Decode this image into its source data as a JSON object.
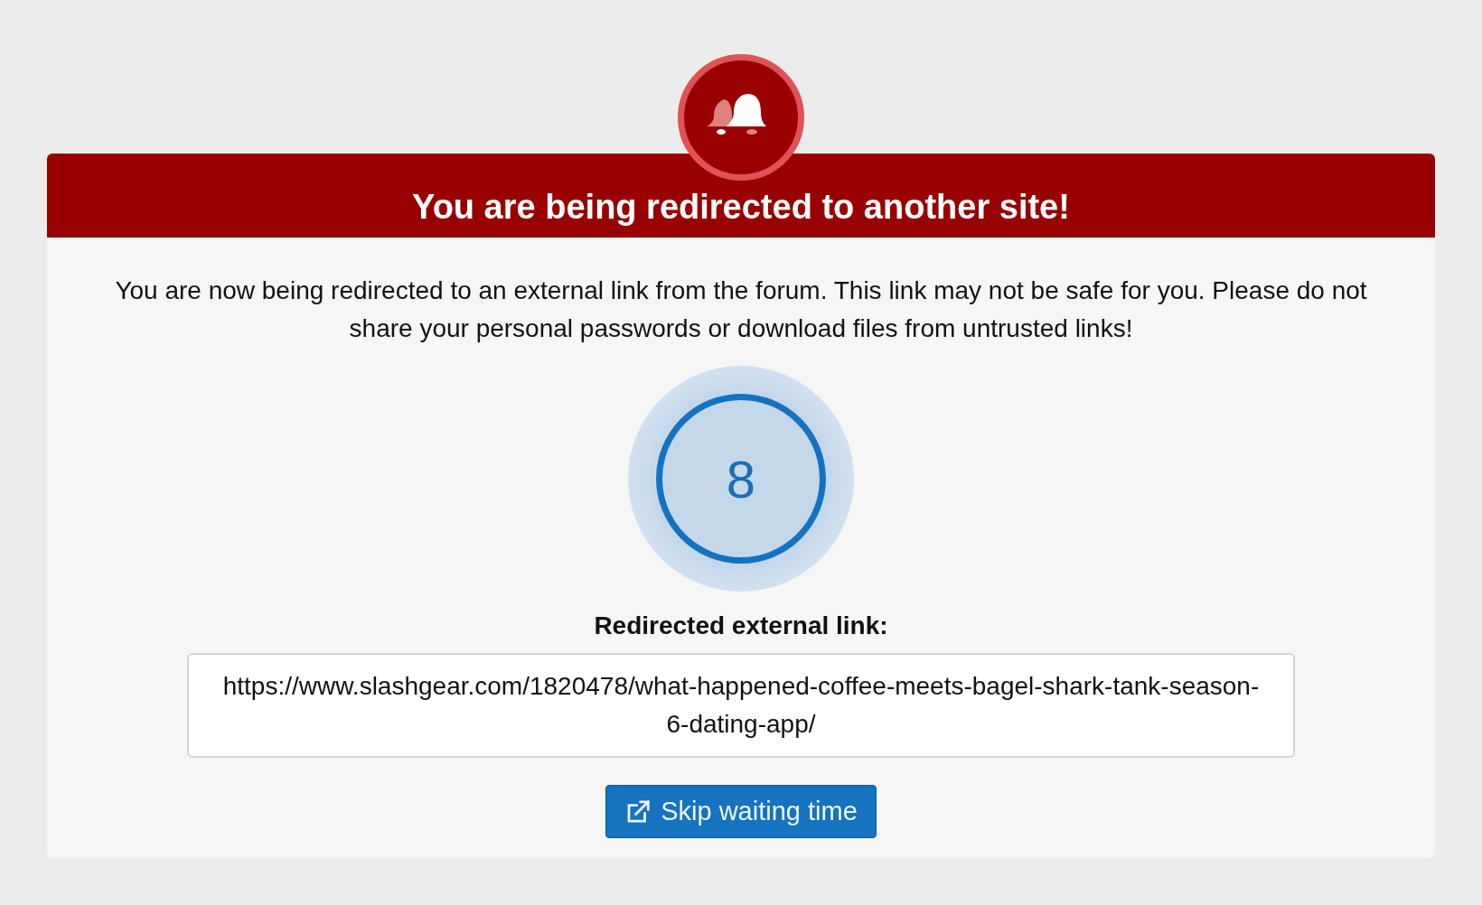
{
  "dialog": {
    "title": "You are being redirected to another site!",
    "message": "You are now being redirected to an external link from the forum. This link may not be safe for you. Please do not share your personal passwords or download files from untrusted links!"
  },
  "countdown": {
    "value": "8"
  },
  "link": {
    "label": "Redirected external link:",
    "value": "https://www.slashgear.com/1820478/what-happened-coffee-meets-bagel-shark-tank-season-6-dating-app/"
  },
  "button": {
    "label": "Skip waiting time"
  }
}
